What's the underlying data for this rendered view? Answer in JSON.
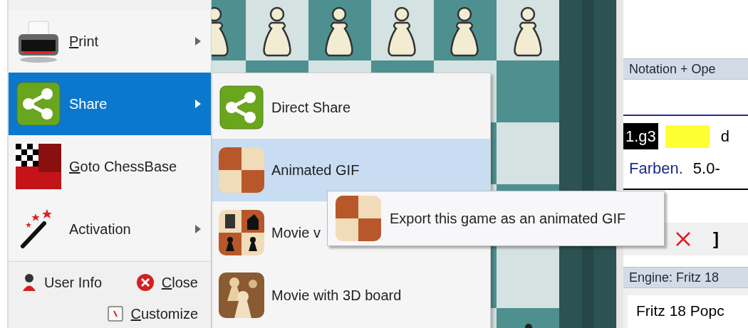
{
  "main_menu": {
    "items": [
      {
        "label": "Print",
        "mnemonic": true,
        "has_submenu": true,
        "selected": false
      },
      {
        "label": "Share",
        "mnemonic": false,
        "has_submenu": true,
        "selected": true
      },
      {
        "label": "Goto ChessBase",
        "mnemonic": true,
        "has_submenu": false,
        "selected": false
      },
      {
        "label": "Activation",
        "mnemonic": false,
        "has_submenu": true,
        "selected": false
      }
    ],
    "footer": [
      {
        "label": "User Info",
        "mnemonic": false
      },
      {
        "label": "Close",
        "mnemonic": true
      },
      {
        "label": "Customize",
        "mnemonic": true
      }
    ]
  },
  "share_submenu": {
    "items": [
      {
        "label": "Direct Share",
        "selected": false
      },
      {
        "label": "Animated GIF",
        "selected": true
      },
      {
        "label": "Movie v",
        "selected": false
      },
      {
        "label": "Movie with 3D board",
        "selected": false
      }
    ]
  },
  "tooltip": {
    "text": "Export this game as an animated GIF"
  },
  "notation_panel": {
    "title": "Notation + Ope",
    "current_move": "1.g3",
    "move_2": "d",
    "comment": "Farben.",
    "score": "5.0-",
    "toolbar_bracket": "]"
  },
  "engine_panel": {
    "title": "Engine: Fritz 18",
    "engine_name": "Fritz 18 Popc"
  }
}
